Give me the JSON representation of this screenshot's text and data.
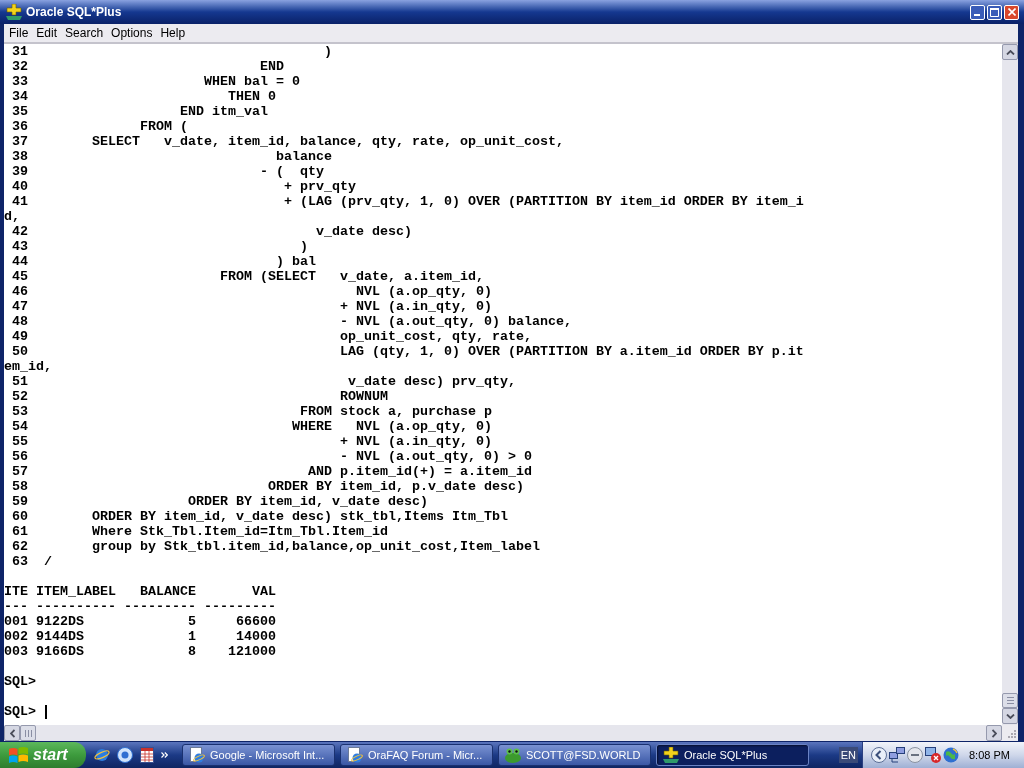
{
  "window": {
    "title": "Oracle SQL*Plus"
  },
  "menu": [
    "File",
    "Edit",
    "Search",
    "Options",
    "Help"
  ],
  "terminal": {
    "listing": [
      {
        "number": "31",
        "code": "                                   )"
      },
      {
        "number": "32",
        "code": "                           END"
      },
      {
        "number": "33",
        "code": "                    WHEN bal = 0"
      },
      {
        "number": "34",
        "code": "                       THEN 0"
      },
      {
        "number": "35",
        "code": "                 END itm_val"
      },
      {
        "number": "36",
        "code": "            FROM ("
      },
      {
        "number": "37",
        "code": "      SELECT   v_date, item_id, balance, qty, rate, op_unit_cost,"
      },
      {
        "number": "38",
        "code": "                             balance"
      },
      {
        "number": "39",
        "code": "                           - (  qty"
      },
      {
        "number": "40",
        "code": "                              + prv_qty"
      },
      {
        "number": "41",
        "code": "                              + (LAG (prv_qty, 1, 0) OVER (PARTITION BY item_id ORDER BY item_i"
      },
      {
        "code": "d,"
      },
      {
        "number": "42",
        "code": "                                  v_date desc)"
      },
      {
        "number": "43",
        "code": "                                )"
      },
      {
        "number": "44",
        "code": "                             ) bal"
      },
      {
        "number": "45",
        "code": "                      FROM (SELECT   v_date, a.item_id,"
      },
      {
        "number": "46",
        "code": "                                       NVL (a.op_qty, 0)"
      },
      {
        "number": "47",
        "code": "                                     + NVL (a.in_qty, 0)"
      },
      {
        "number": "48",
        "code": "                                     - NVL (a.out_qty, 0) balance,"
      },
      {
        "number": "49",
        "code": "                                     op_unit_cost, qty, rate,"
      },
      {
        "number": "50",
        "code": "                                     LAG (qty, 1, 0) OVER (PARTITION BY a.item_id ORDER BY p.it"
      },
      {
        "code": "em_id,"
      },
      {
        "number": "51",
        "code": "                                      v_date desc) prv_qty,"
      },
      {
        "number": "52",
        "code": "                                     ROWNUM"
      },
      {
        "number": "53",
        "code": "                                FROM stock a, purchase p"
      },
      {
        "number": "54",
        "code": "                               WHERE   NVL (a.op_qty, 0)"
      },
      {
        "number": "55",
        "code": "                                     + NVL (a.in_qty, 0)"
      },
      {
        "number": "56",
        "code": "                                     - NVL (a.out_qty, 0) > 0"
      },
      {
        "number": "57",
        "code": "                                 AND p.item_id(+) = a.item_id"
      },
      {
        "number": "58",
        "code": "                            ORDER BY item_id, p.v_date desc)"
      },
      {
        "number": "59",
        "code": "                  ORDER BY item_id, v_date desc)"
      },
      {
        "number": "60",
        "code": "      ORDER BY item_id, v_date desc) stk_tbl,Items Itm_Tbl"
      },
      {
        "number": "61",
        "code": "      Where Stk_Tbl.Item_id=Itm_Tbl.Item_id"
      },
      {
        "number": "62",
        "code": "      group by Stk_tbl.item_id,balance,op_unit_cost,Item_label"
      },
      {
        "number": "63",
        "code": "/"
      }
    ],
    "result": {
      "columns": [
        {
          "header": "ITE",
          "rule": "---",
          "kind": "text"
        },
        {
          "header": "ITEM_LABEL",
          "rule": "----------",
          "kind": "text"
        },
        {
          "header": "BALANCE",
          "rule": "---------",
          "kind": "number"
        },
        {
          "header": "VAL",
          "rule": "---------",
          "kind": "number"
        }
      ],
      "rows": [
        [
          "001",
          "9122DS",
          "5",
          "66600"
        ],
        [
          "002",
          "9144DS",
          "1",
          "14000"
        ],
        [
          "003",
          "9166DS",
          "8",
          "121000"
        ]
      ]
    },
    "prompts": [
      {
        "text": "SQL>",
        "cursor": false
      },
      {
        "text": "SQL>",
        "cursor": true
      }
    ]
  },
  "taskbar": {
    "start_button": "start",
    "tasks": [
      {
        "label": "Google - Microsoft Int...",
        "kind": "browser",
        "selected": false
      },
      {
        "label": "OraFAQ Forum - Micr...",
        "kind": "browser",
        "selected": false
      },
      {
        "label": "SCOTT@FSD.WORLD",
        "kind": "frog",
        "selected": false
      },
      {
        "label": "Oracle SQL*Plus",
        "kind": "sqlplus",
        "selected": true
      }
    ],
    "language": "EN",
    "clock": "8:08 PM"
  }
}
